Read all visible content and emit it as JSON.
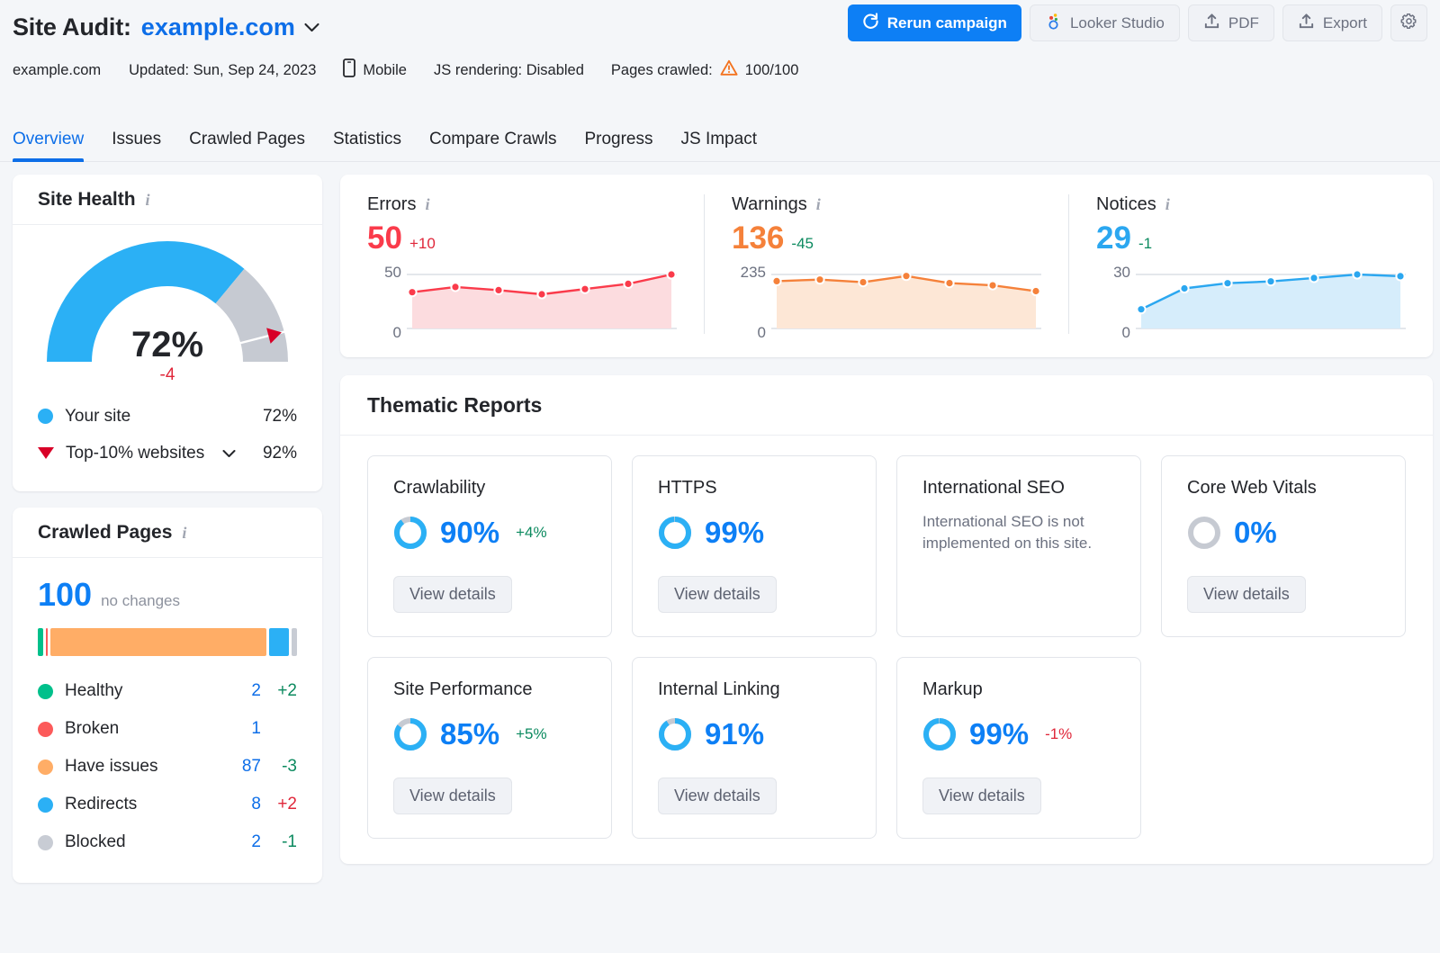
{
  "header": {
    "title_prefix": "Site Audit:",
    "domain": "example.com",
    "meta": {
      "site": "example.com",
      "updated": "Updated: Sun, Sep 24, 2023",
      "device": "Mobile",
      "js_rendering": "JS rendering: Disabled",
      "pages_crawled_label": "Pages crawled:",
      "pages_crawled_value": "100/100"
    },
    "actions": {
      "rerun": "Rerun campaign",
      "looker": "Looker Studio",
      "pdf": "PDF",
      "export": "Export"
    }
  },
  "tabs": [
    {
      "label": "Overview",
      "active": true
    },
    {
      "label": "Issues",
      "active": false
    },
    {
      "label": "Crawled Pages",
      "active": false
    },
    {
      "label": "Statistics",
      "active": false
    },
    {
      "label": "Compare Crawls",
      "active": false
    },
    {
      "label": "Progress",
      "active": false
    },
    {
      "label": "JS Impact",
      "active": false
    }
  ],
  "site_health": {
    "title": "Site Health",
    "score": "72%",
    "delta": "-4",
    "legend": [
      {
        "label": "Your site",
        "value": "72%",
        "color": "#2bb0f5",
        "marker": "dot"
      },
      {
        "label": "Top-10% websites",
        "value": "92%",
        "color": "#d80027",
        "marker": "triangle"
      }
    ]
  },
  "crawled_pages": {
    "title": "Crawled Pages",
    "total": "100",
    "total_note": "no changes",
    "rows": [
      {
        "label": "Healthy",
        "count": "2",
        "delta": "+2",
        "delta_sign": "pos",
        "color": "#00c08b",
        "pct": 2
      },
      {
        "label": "Broken",
        "count": "1",
        "delta": "",
        "delta_sign": "",
        "color": "#fc5a5a",
        "pct": 1
      },
      {
        "label": "Have issues",
        "count": "87",
        "delta": "-3",
        "delta_sign": "pos",
        "color": "#ffad66",
        "pct": 87
      },
      {
        "label": "Redirects",
        "count": "8",
        "delta": "+2",
        "delta_sign": "neg",
        "color": "#2bb0f5",
        "pct": 8
      },
      {
        "label": "Blocked",
        "count": "2",
        "delta": "-1",
        "delta_sign": "pos",
        "color": "#c8ccd4",
        "pct": 2
      }
    ]
  },
  "stats": [
    {
      "name": "Errors",
      "value": "50",
      "delta": "+10",
      "delta_sign": "neg",
      "color": "#fa3b4b",
      "fill": "#fcdcdf",
      "axis_top": "50",
      "axis_bottom": "0"
    },
    {
      "name": "Warnings",
      "value": "136",
      "delta": "-45",
      "delta_sign": "pos",
      "color": "#f5813a",
      "fill": "#fde7d6",
      "axis_top": "235",
      "axis_bottom": "0"
    },
    {
      "name": "Notices",
      "value": "29",
      "delta": "-1",
      "delta_sign": "pos",
      "color": "#2ba7f0",
      "fill": "#d6edfb",
      "axis_top": "30",
      "axis_bottom": "0"
    }
  ],
  "thematic": {
    "title": "Thematic Reports",
    "view_details": "View details",
    "cards": [
      {
        "name": "Crawlability",
        "pct": "90%",
        "value": 90,
        "delta": "+4%",
        "delta_sign": "pos",
        "has_ring": true,
        "note": ""
      },
      {
        "name": "HTTPS",
        "pct": "99%",
        "value": 99,
        "delta": "",
        "delta_sign": "",
        "has_ring": true,
        "note": ""
      },
      {
        "name": "International SEO",
        "pct": "",
        "value": null,
        "delta": "",
        "delta_sign": "",
        "has_ring": false,
        "note": "International SEO is not implemented on this site."
      },
      {
        "name": "Core Web Vitals",
        "pct": "0%",
        "value": 0,
        "delta": "",
        "delta_sign": "",
        "has_ring": true,
        "note": ""
      },
      {
        "name": "Site Performance",
        "pct": "85%",
        "value": 85,
        "delta": "+5%",
        "delta_sign": "pos",
        "has_ring": true,
        "note": ""
      },
      {
        "name": "Internal Linking",
        "pct": "91%",
        "value": 91,
        "delta": "",
        "delta_sign": "",
        "has_ring": true,
        "note": ""
      },
      {
        "name": "Markup",
        "pct": "99%",
        "value": 99,
        "delta": "-1%",
        "delta_sign": "neg",
        "has_ring": true,
        "note": ""
      }
    ]
  },
  "chart_data": [
    {
      "type": "gauge",
      "title": "Site Health",
      "value": 72,
      "benchmark": 92,
      "range": [
        0,
        100
      ],
      "delta": -4,
      "series": [
        {
          "name": "Your site",
          "value": 72,
          "color": "#2bb0f5"
        },
        {
          "name": "Top-10% websites",
          "value": 92,
          "color": "#d80027"
        }
      ]
    },
    {
      "type": "bar",
      "title": "Crawled Pages",
      "orientation": "horizontal-stacked",
      "total": 100,
      "categories": [
        "Healthy",
        "Broken",
        "Have issues",
        "Redirects",
        "Blocked"
      ],
      "values": [
        2,
        1,
        87,
        8,
        2
      ],
      "colors": [
        "#00c08b",
        "#fc5a5a",
        "#ffad66",
        "#2bb0f5",
        "#c8ccd4"
      ],
      "ylabel": "",
      "xlabel": ""
    },
    {
      "type": "area",
      "title": "Errors",
      "values": [
        33,
        38,
        35,
        31,
        36,
        41,
        50
      ],
      "x": [
        1,
        2,
        3,
        4,
        5,
        6,
        7
      ],
      "ylim": [
        0,
        50
      ],
      "ytick_labels": [
        "0",
        "50"
      ],
      "color": "#fa3b4b",
      "current": 50,
      "delta": 10
    },
    {
      "type": "area",
      "title": "Warnings",
      "values": [
        205,
        212,
        200,
        228,
        196,
        186,
        160
      ],
      "x": [
        1,
        2,
        3,
        4,
        5,
        6,
        7
      ],
      "ylim": [
        0,
        235
      ],
      "ytick_labels": [
        "0",
        "235"
      ],
      "color": "#f5813a",
      "current": 136,
      "delta": -45
    },
    {
      "type": "area",
      "title": "Notices",
      "values": [
        10,
        22,
        25,
        26,
        28,
        30,
        29
      ],
      "x": [
        1,
        2,
        3,
        4,
        5,
        6,
        7
      ],
      "ylim": [
        0,
        30
      ],
      "ytick_labels": [
        "0",
        "30"
      ],
      "color": "#2ba7f0",
      "current": 29,
      "delta": -1
    }
  ]
}
